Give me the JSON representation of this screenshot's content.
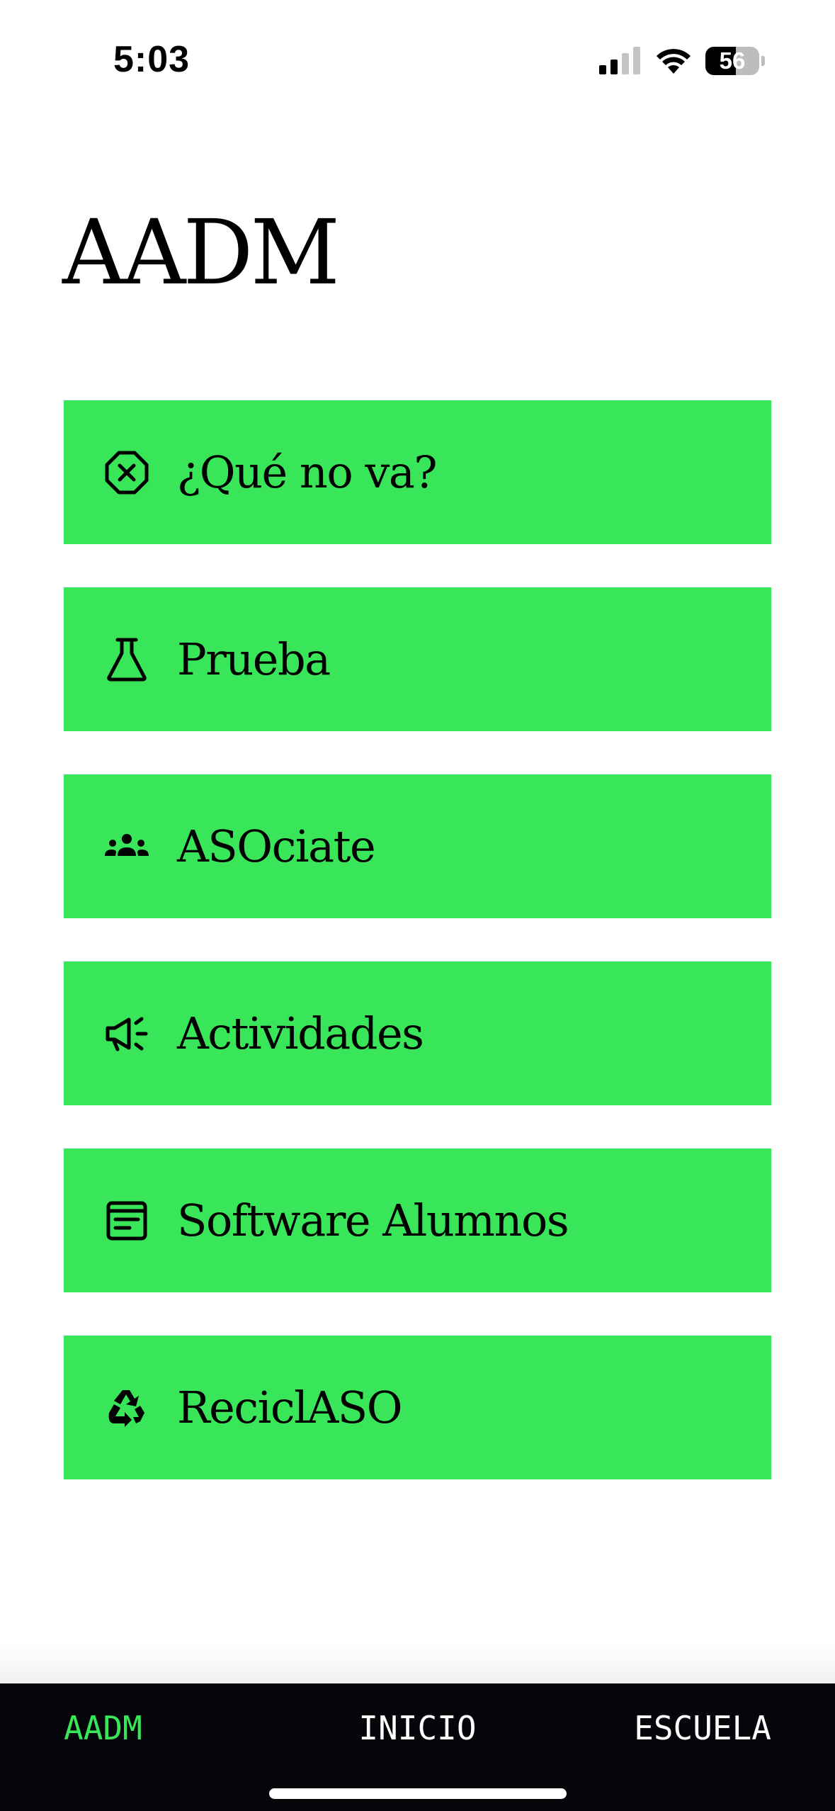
{
  "status_bar": {
    "time": "5:03",
    "signal_icon": "cellular-signal-icon",
    "wifi_icon": "wifi-icon",
    "battery_level": 56,
    "battery_text": "56"
  },
  "title": "AADM",
  "colors": {
    "accent_green": "#3ae659",
    "tab_bar_background": "#05050a",
    "text": "#000000"
  },
  "menu": {
    "items": [
      {
        "label": "¿Qué no va?",
        "icon": "x-circle-icon"
      },
      {
        "label": "Prueba",
        "icon": "flask-icon"
      },
      {
        "label": "ASOciate",
        "icon": "group-icon"
      },
      {
        "label": "Actividades",
        "icon": "megaphone-icon"
      },
      {
        "label": "Software Alumnos",
        "icon": "document-icon"
      },
      {
        "label": "ReciclASO",
        "icon": "recycle-icon"
      }
    ]
  },
  "tab_bar": {
    "tabs": [
      {
        "label": "AADM",
        "active": true
      },
      {
        "label": "INICIO",
        "active": false
      },
      {
        "label": "ESCUELA",
        "active": false
      }
    ]
  }
}
